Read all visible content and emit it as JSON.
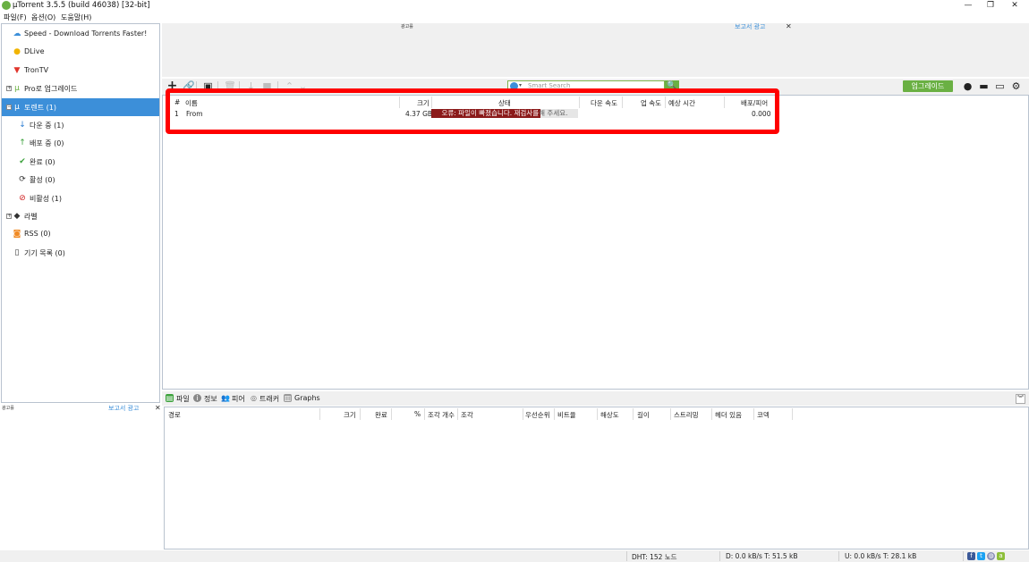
{
  "window": {
    "title": "µTorrent 3.5.5  (build 46038) [32-bit]",
    "minimize": "—",
    "maximize": "❐",
    "close": "✕"
  },
  "menu": [
    "파일(F)",
    "옵션(O)",
    "도움말(H)"
  ],
  "sidebar": {
    "items": [
      {
        "label": "Speed - Download Torrents Faster!",
        "icon": "cloud-icon",
        "glyph": "☁",
        "color": "#3c8fd9"
      },
      {
        "label": "DLive",
        "icon": "dlive-icon",
        "glyph": "●",
        "color": "#f1b400"
      },
      {
        "label": "TronTV",
        "icon": "trontv-icon",
        "glyph": "▼",
        "color": "#e0342b"
      },
      {
        "label": "Pro로 업그레이드",
        "icon": "utorrent-pro-icon",
        "glyph": "µ",
        "color": "#6ab043"
      },
      {
        "label": "토렌트 (1)",
        "icon": "torrents-icon",
        "glyph": "µ",
        "color": "#6ab043"
      },
      {
        "label": "다운 중 (1)",
        "icon": "download-arrow-icon",
        "glyph": "↓",
        "color": "#2a7cd2"
      },
      {
        "label": "배포 중 (0)",
        "icon": "upload-arrow-icon",
        "glyph": "↑",
        "color": "#3aa13a"
      },
      {
        "label": "완료 (0)",
        "icon": "checkmark-icon",
        "glyph": "✔",
        "color": "#3aa13a"
      },
      {
        "label": "활성 (0)",
        "icon": "refresh-icon",
        "glyph": "⟳",
        "color": "#333333"
      },
      {
        "label": "비활성 (1)",
        "icon": "inactive-icon",
        "glyph": "⊘",
        "color": "#d02020"
      },
      {
        "label": "라벨",
        "icon": "label-tag-icon",
        "glyph": "◆",
        "color": "#333333"
      },
      {
        "label": "RSS (0)",
        "icon": "rss-icon",
        "glyph": "◙",
        "color": "#f08a24"
      },
      {
        "label": "기기 목록 (0)",
        "icon": "device-icon",
        "glyph": "▯",
        "color": "#333333"
      }
    ],
    "ad_left_label": "광고를",
    "ad_left_report": "보고서 광고",
    "ad_close": "✕"
  },
  "top_ad": {
    "label": "광고를",
    "report": "보고서 광고",
    "close": "✕"
  },
  "toolbar": {
    "search_placeholder": "Smart Search",
    "search_glyph": "🔍",
    "upgrade_label": "업그레이드"
  },
  "torrent_list": {
    "columns": [
      "#",
      "이름",
      "크기",
      "상태",
      "다운 속도",
      "업 속도",
      "예상 시간",
      "배포/피어"
    ],
    "rows": [
      {
        "num": "1",
        "name": "From",
        "size": "4.37 GB",
        "status_main": "오류: 파일이 빠졌습니다. 재검사를",
        "status_over": "해 주세요.",
        "progress": 0.745,
        "ratio": "0.000"
      }
    ]
  },
  "detail_tabs": [
    "파일",
    "정보",
    "피어",
    "트래커",
    "Graphs"
  ],
  "files_columns": [
    "경로",
    "크기",
    "완료",
    "%",
    "조각 개수",
    "조각",
    "우선순위",
    "비트율",
    "해상도",
    "길이",
    "스트리밍",
    "헤더 있음",
    "코덱"
  ],
  "statusbar": {
    "dht": "DHT: 152 노드",
    "down": "D: 0.0 kB/s T: 51.5 kB",
    "up": "U: 0.0 kB/s T: 28.1 kB"
  }
}
